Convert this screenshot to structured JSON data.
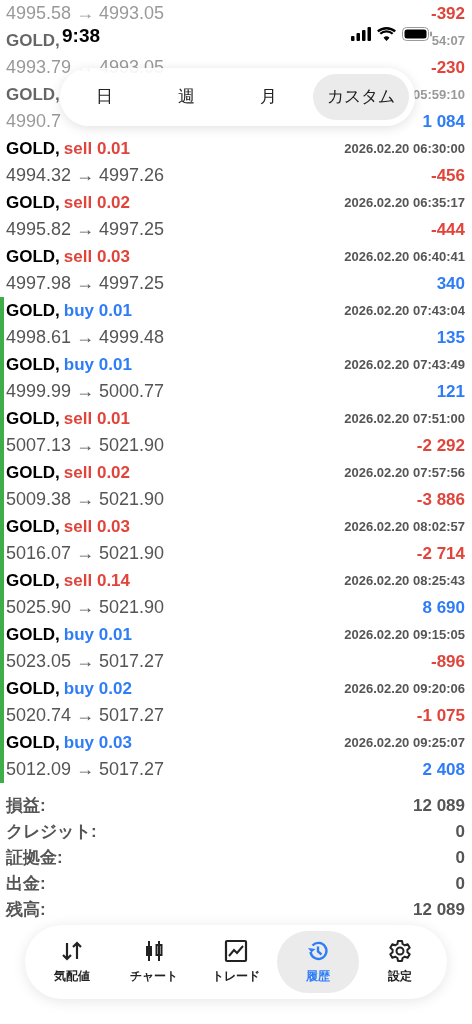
{
  "status_bar": {
    "time": "9:38"
  },
  "period_tabs": [
    {
      "label": "日",
      "selected": false
    },
    {
      "label": "週",
      "selected": false
    },
    {
      "label": "月",
      "selected": false
    },
    {
      "label": "カスタム",
      "selected": true
    }
  ],
  "deals": [
    {
      "faded": true,
      "marked": false,
      "prices": "4995.58 → 4993.05",
      "profit": "-392",
      "color": "#e0443a"
    },
    {
      "faded": true,
      "marked": false,
      "symbol": "GOLD,",
      "time": "54:07",
      "prices": "4993.79 → 4993.05",
      "profit": "-230",
      "color": "#e0443a"
    },
    {
      "faded": true,
      "marked": false,
      "symbol": "GOLD,",
      "time": "05:59:10",
      "prices": "4990.7",
      "profit": "1 084",
      "color": "#2f7df6"
    },
    {
      "faded": false,
      "marked": false,
      "symbol": "GOLD,",
      "side": "sell",
      "volume": "0.01",
      "time": "2026.02.20 06:30:00",
      "prices": "4994.32 → 4997.26",
      "profit": "-456",
      "color": "#e0443a"
    },
    {
      "faded": false,
      "marked": false,
      "symbol": "GOLD,",
      "side": "sell",
      "volume": "0.02",
      "time": "2026.02.20 06:35:17",
      "prices": "4995.82 → 4997.25",
      "profit": "-444",
      "color": "#e0443a"
    },
    {
      "faded": false,
      "marked": false,
      "symbol": "GOLD,",
      "side": "sell",
      "volume": "0.03",
      "time": "2026.02.20 06:40:41",
      "prices": "4997.98 → 4997.25",
      "profit": "340",
      "color": "#2f7df6"
    },
    {
      "faded": false,
      "marked": true,
      "symbol": "GOLD,",
      "side": "buy",
      "volume": "0.01",
      "time": "2026.02.20 07:43:04",
      "prices": "4998.61 → 4999.48",
      "profit": "135",
      "color": "#2f7df6"
    },
    {
      "faded": false,
      "marked": true,
      "symbol": "GOLD,",
      "side": "buy",
      "volume": "0.01",
      "time": "2026.02.20 07:43:49",
      "prices": "4999.99 → 5000.77",
      "profit": "121",
      "color": "#2f7df6"
    },
    {
      "faded": false,
      "marked": true,
      "symbol": "GOLD,",
      "side": "sell",
      "volume": "0.01",
      "time": "2026.02.20 07:51:00",
      "prices": "5007.13 → 5021.90",
      "profit": "-2 292",
      "color": "#e0443a"
    },
    {
      "faded": false,
      "marked": true,
      "symbol": "GOLD,",
      "side": "sell",
      "volume": "0.02",
      "time": "2026.02.20 07:57:56",
      "prices": "5009.38 → 5021.90",
      "profit": "-3 886",
      "color": "#e0443a"
    },
    {
      "faded": false,
      "marked": true,
      "symbol": "GOLD,",
      "side": "sell",
      "volume": "0.03",
      "time": "2026.02.20 08:02:57",
      "prices": "5016.07 → 5021.90",
      "profit": "-2 714",
      "color": "#e0443a"
    },
    {
      "faded": false,
      "marked": true,
      "symbol": "GOLD,",
      "side": "sell",
      "volume": "0.14",
      "time": "2026.02.20 08:25:43",
      "prices": "5025.90 → 5021.90",
      "profit": "8 690",
      "color": "#2f7df6"
    },
    {
      "faded": false,
      "marked": true,
      "symbol": "GOLD,",
      "side": "buy",
      "volume": "0.01",
      "time": "2026.02.20 09:15:05",
      "prices": "5023.05 → 5017.27",
      "profit": "-896",
      "color": "#e0443a"
    },
    {
      "faded": false,
      "marked": true,
      "symbol": "GOLD,",
      "side": "buy",
      "volume": "0.02",
      "time": "2026.02.20 09:20:06",
      "prices": "5020.74 → 5017.27",
      "profit": "-1 075",
      "color": "#e0443a"
    },
    {
      "faded": false,
      "marked": true,
      "symbol": "GOLD,",
      "side": "buy",
      "volume": "0.03",
      "time": "2026.02.20 09:25:07",
      "prices": "5012.09 → 5017.27",
      "profit": "2 408",
      "color": "#2f7df6"
    }
  ],
  "summary": [
    {
      "label": "損益:",
      "value": "12 089"
    },
    {
      "label": "クレジット:",
      "value": "0"
    },
    {
      "label": "証拠金:",
      "value": "0"
    },
    {
      "label": "出金:",
      "value": "0"
    },
    {
      "label": "残高:",
      "value": "12 089"
    }
  ],
  "tab_bar": [
    {
      "kind": "quotes",
      "label": "気配値",
      "selected": false
    },
    {
      "kind": "chart",
      "label": "チャート",
      "selected": false
    },
    {
      "kind": "trade",
      "label": "トレード",
      "selected": false
    },
    {
      "kind": "history",
      "label": "履歴",
      "selected": true
    },
    {
      "kind": "settings",
      "label": "設定",
      "selected": false
    }
  ]
}
